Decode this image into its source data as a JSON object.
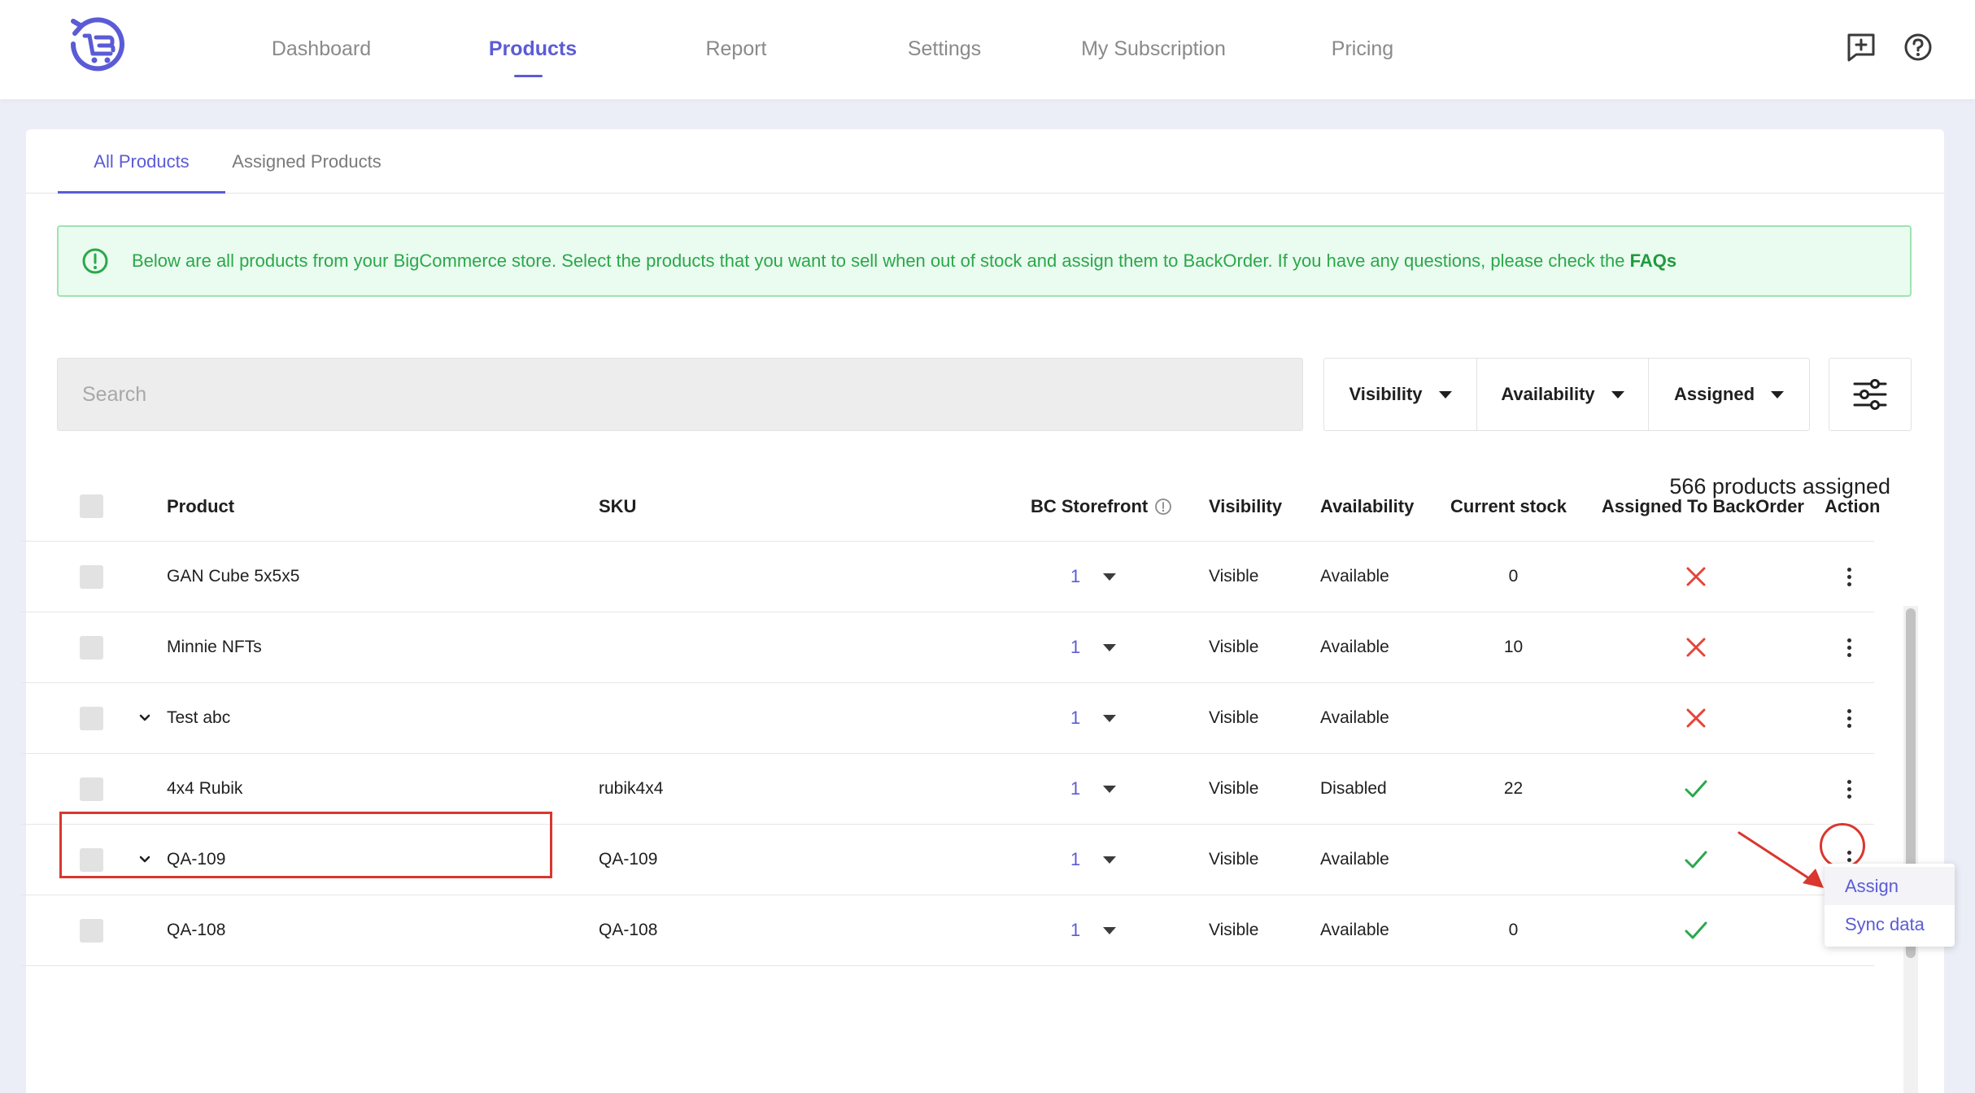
{
  "nav": {
    "items": [
      {
        "label": "Dashboard"
      },
      {
        "label": "Products"
      },
      {
        "label": "Report"
      },
      {
        "label": "Settings"
      },
      {
        "label": "My Subscription"
      },
      {
        "label": "Pricing"
      }
    ],
    "active": "Products",
    "icons": [
      "feedback-icon",
      "help-icon"
    ]
  },
  "tabs": [
    {
      "label": "All Products"
    },
    {
      "label": "Assigned Products"
    }
  ],
  "banner": {
    "text": "Below are all products from your BigCommerce store. Select the products that you want to sell when out of stock and assign them to BackOrder. If you have any questions, please check the ",
    "link": "FAQs"
  },
  "search": {
    "placeholder": "Search"
  },
  "filters": [
    {
      "label": "Visibility"
    },
    {
      "label": "Availability"
    },
    {
      "label": "Assigned"
    }
  ],
  "assigned_count": "566 products assigned",
  "table": {
    "headers": {
      "product": "Product",
      "sku": "SKU",
      "storefront": "BC Storefront",
      "visibility": "Visibility",
      "availability": "Availability",
      "stock": "Current stock",
      "assigned": "Assigned To BackOrder",
      "action": "Action"
    },
    "rows": [
      {
        "product": "GAN Cube 5x5x5",
        "sku": "",
        "storefront": "1",
        "visibility": "Visible",
        "availability": "Available",
        "stock": "0",
        "assigned": false,
        "expandable": false
      },
      {
        "product": "Minnie NFTs",
        "sku": "",
        "storefront": "1",
        "visibility": "Visible",
        "availability": "Available",
        "stock": "10",
        "assigned": false,
        "expandable": false
      },
      {
        "product": "Test abc",
        "sku": "",
        "storefront": "1",
        "visibility": "Visible",
        "availability": "Available",
        "stock": "",
        "assigned": false,
        "expandable": true
      },
      {
        "product": "4x4 Rubik",
        "sku": "rubik4x4",
        "storefront": "1",
        "visibility": "Visible",
        "availability": "Disabled",
        "stock": "22",
        "assigned": true,
        "expandable": false
      },
      {
        "product": "QA-109",
        "sku": "QA-109",
        "storefront": "1",
        "visibility": "Visible",
        "availability": "Available",
        "stock": "",
        "assigned": true,
        "expandable": true
      },
      {
        "product": "QA-108",
        "sku": "QA-108",
        "storefront": "1",
        "visibility": "Visible",
        "availability": "Available",
        "stock": "0",
        "assigned": true,
        "expandable": false
      }
    ]
  },
  "action_menu": {
    "items": [
      {
        "label": "Assign"
      },
      {
        "label": "Sync data"
      }
    ]
  },
  "colors": {
    "accent": "#5b5bd6",
    "success": "#2aa84a",
    "danger": "#e5443a",
    "annotation": "#d9372f"
  }
}
